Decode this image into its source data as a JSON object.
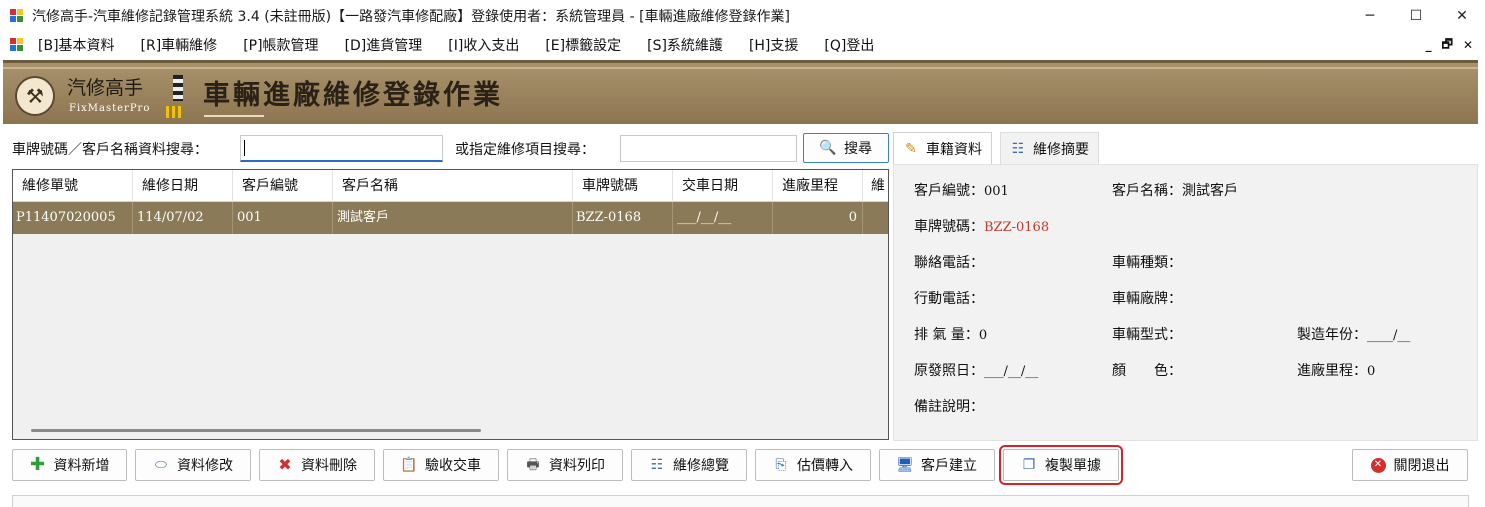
{
  "window": {
    "title": "汽修高手-汽車維修記錄管理系統 3.4 (未註冊版)【一路發汽車修配廠】登錄使用者：系統管理員 - [車輛進廠維修登錄作業]",
    "minimize": "─",
    "maximize": "☐",
    "close": "✕"
  },
  "menu": {
    "items": [
      "[B]基本資料",
      "[R]車輛維修",
      "[P]帳款管理",
      "[D]進貨管理",
      "[I]收入支出",
      "[E]標籤設定",
      "[S]系統維護",
      "[H]支援",
      "[Q]登出"
    ],
    "mdi_min": "_",
    "mdi_restore": "🗗",
    "mdi_close": "✕"
  },
  "banner": {
    "logo_cn": "汽修高手",
    "logo_en": "FixMasterPro",
    "title": "車輛進廠維修登錄作業"
  },
  "search": {
    "plate_label": "車牌號碼／客戶名稱資料搜尋：",
    "plate_value": "",
    "item_label": "或指定維修項目搜尋：",
    "item_value": "",
    "search_button": "搜尋"
  },
  "grid": {
    "columns": [
      "維修單號",
      "維修日期",
      "客戶編號",
      "客戶名稱",
      "車牌號碼",
      "交車日期",
      "進廠里程",
      "維"
    ],
    "rows": [
      [
        "P11407020005",
        "114/07/02",
        "001",
        "測試客戶",
        "BZZ-0168",
        "___/__/__",
        "0",
        ""
      ]
    ]
  },
  "tabs": {
    "vehicle": "車籍資料",
    "summary": "維修摘要"
  },
  "detail": {
    "customer_no_label": "客戶編號：",
    "customer_no": "001",
    "customer_name_label": "客戶名稱：",
    "customer_name": "測試客戶",
    "plate_label": "車牌號碼：",
    "plate": "BZZ-0168",
    "phone_label": "聯絡電話：",
    "phone": "",
    "vehicle_type_label": "車輛種類：",
    "vehicle_type": "",
    "mobile_label": "行動電話：",
    "mobile": "",
    "brand_label": "車輛廠牌：",
    "brand": "",
    "displacement_label": "排 氣 量：",
    "displacement": "0",
    "model_label": "車輛型式：",
    "model": "",
    "year_label": "製造年份：",
    "year": "____/__",
    "license_date_label": "原發照日：",
    "license_date": "___/__/__",
    "color_label": "顏　　色：",
    "color": "",
    "mileage_label": "進廠里程：",
    "mileage": "0",
    "note_label": "備註說明：",
    "note": ""
  },
  "buttons": {
    "add": "資料新增",
    "edit": "資料修改",
    "delete": "資料刪除",
    "accept": "驗收交車",
    "print": "資料列印",
    "overview": "維修總覽",
    "quote": "估價轉入",
    "customer": "客戶建立",
    "copy": "複製單據",
    "exit": "關閉退出"
  },
  "colors": {
    "selected_row": "#8b7a57",
    "banner": "#a8926c",
    "plate_red": "#c0392b",
    "highlight_border": "#d6222a"
  }
}
